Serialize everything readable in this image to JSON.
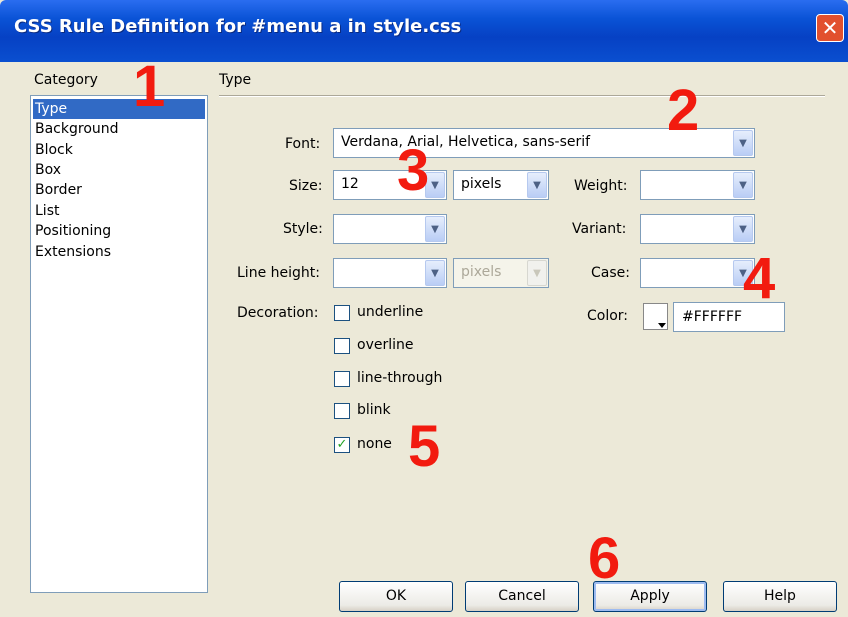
{
  "window": {
    "title": "CSS Rule Definition for #menu a in style.css",
    "close_glyph": "✕"
  },
  "category": {
    "heading": "Category",
    "items": [
      "Type",
      "Background",
      "Block",
      "Box",
      "Border",
      "List",
      "Positioning",
      "Extensions"
    ],
    "selected": "Type"
  },
  "section_title": "Type",
  "form": {
    "font": {
      "label": "Font:",
      "value": "Verdana, Arial, Helvetica, sans-serif"
    },
    "size": {
      "label": "Size:",
      "value": "12",
      "unit": "pixels"
    },
    "weight": {
      "label": "Weight:",
      "value": ""
    },
    "style": {
      "label": "Style:",
      "value": ""
    },
    "variant": {
      "label": "Variant:",
      "value": ""
    },
    "line_height": {
      "label": "Line height:",
      "value": "",
      "unit": "pixels"
    },
    "case": {
      "label": "Case:",
      "value": ""
    },
    "color": {
      "label": "Color:",
      "value": "#FFFFFF"
    },
    "decoration": {
      "label": "Decoration:",
      "options": [
        {
          "label": "underline",
          "checked": false
        },
        {
          "label": "overline",
          "checked": false
        },
        {
          "label": "line-through",
          "checked": false
        },
        {
          "label": "blink",
          "checked": false
        },
        {
          "label": "none",
          "checked": true
        }
      ]
    }
  },
  "buttons": {
    "ok": "OK",
    "cancel": "Cancel",
    "apply": "Apply",
    "help": "Help"
  },
  "annotations": [
    "1",
    "2",
    "3",
    "4",
    "5",
    "6"
  ],
  "colors": {
    "accent": "#316ac5",
    "annotation": "#f21b0f",
    "titlebar": "#0a53d6"
  },
  "icons": {
    "dropdown": "chevron-down-icon",
    "check": "checkmark-icon"
  }
}
